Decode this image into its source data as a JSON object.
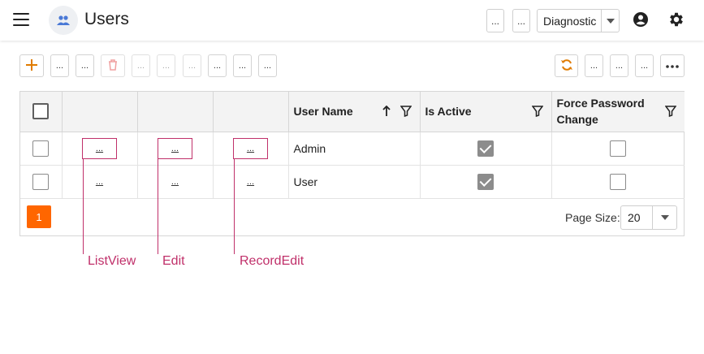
{
  "header": {
    "title": "Users",
    "btn1": "...",
    "btn2": "...",
    "selector_value": "Diagnostic",
    "icons": [
      "menu-icon",
      "users-icon",
      "account-circle-icon",
      "gear-icon"
    ]
  },
  "toolbar": {
    "add_icon": "plus-icon",
    "delete_icon": "trash-icon",
    "refresh_icon": "refresh-icon",
    "more_icon": "more-horizontal-icon",
    "dots": "..."
  },
  "grid": {
    "columns": {
      "user_name": "User Name",
      "is_active": "Is Active",
      "force_password_change_1": "Force Password",
      "force_password_change_2": "Change"
    },
    "rows": [
      {
        "link1": "...",
        "link2": "...",
        "link3": "...",
        "user_name": "Admin",
        "is_active": true,
        "force_password_change": false
      },
      {
        "link1": "...",
        "link2": "...",
        "link3": "...",
        "user_name": "User",
        "is_active": true,
        "force_password_change": false
      }
    ],
    "pager": {
      "current_page": "1",
      "page_size_label": "Page Size:",
      "page_size": "20"
    }
  },
  "annotations": {
    "list_view": "ListView",
    "edit": "Edit",
    "record_edit": "RecordEdit"
  },
  "colors": {
    "accent": "#ff6600",
    "annotation": "#c0306a",
    "header_bg": "#f3f3f3"
  }
}
